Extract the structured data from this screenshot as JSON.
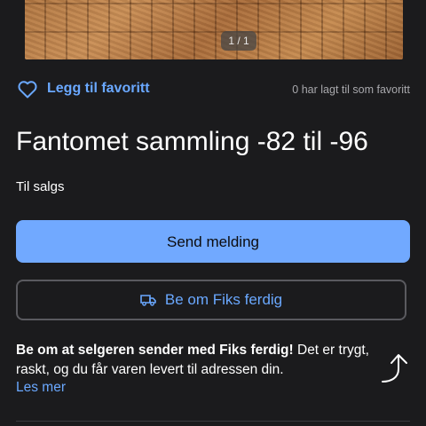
{
  "gallery": {
    "counter": "1 / 1"
  },
  "favorite": {
    "label": "Legg til favoritt",
    "count_text": "0 har lagt til som favoritt"
  },
  "listing": {
    "title": "Fantomet sammling -82 til -96",
    "status": "Til salgs"
  },
  "actions": {
    "send_message": "Send melding",
    "fiks_ferdig": "Be om Fiks ferdig"
  },
  "fiks_info": {
    "bold": "Be om at selgeren sender med Fiks ferdig!",
    "text": " Det er trygt, raskt, og du får varen levert til adressen din.",
    "read_more": "Les mer"
  },
  "colors": {
    "background": "#1b1b1d",
    "accent": "#71a9ff",
    "link": "#6aa8ff"
  },
  "icons": [
    "heart-icon",
    "truck-icon",
    "share-icon"
  ]
}
